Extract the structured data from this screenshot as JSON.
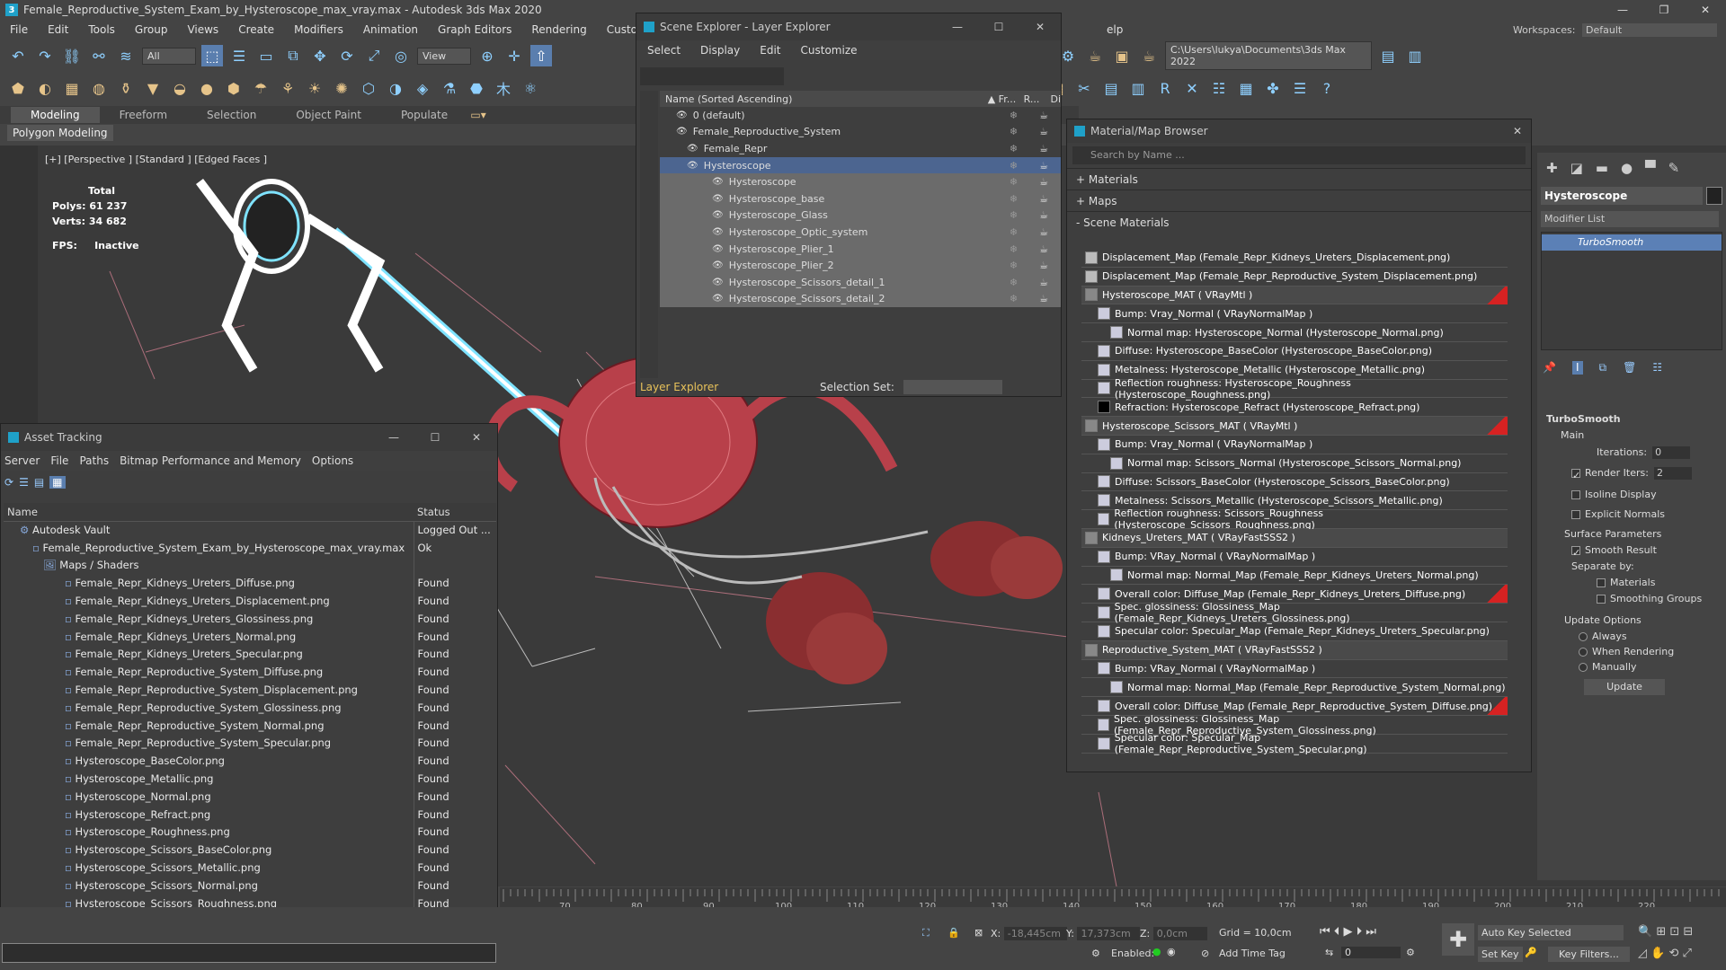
{
  "app": {
    "title": "Female_Reproductive_System_Exam_by_Hysteroscope_max_vray.max - Autodesk 3ds Max 2020",
    "menu": [
      "File",
      "Edit",
      "Tools",
      "Group",
      "Views",
      "Create",
      "Modifiers",
      "Animation",
      "Graph Editors",
      "Rendering",
      "Custo"
    ],
    "menu_tail": "elp",
    "workspaces_label": "Workspaces:",
    "workspace_value": "Default",
    "selection_filter": "All",
    "ref_coord": "View",
    "project_path": "C:\\Users\\lukya\\Documents\\3ds Max 2022"
  },
  "ribbon": {
    "tabs": [
      "Modeling",
      "Freeform",
      "Selection",
      "Object Paint",
      "Populate"
    ],
    "active": "Modeling",
    "sub": "Polygon Modeling"
  },
  "viewport": {
    "label": "[+] [Perspective ] [Standard ] [Edged Faces ]",
    "total_label": "Total",
    "polys_label": "Polys:",
    "polys": "61 237",
    "verts_label": "Verts:",
    "verts": "34 682",
    "fps_label": "FPS:",
    "fps": "Inactive"
  },
  "scene_explorer": {
    "title": "Scene Explorer - Layer Explorer",
    "menu": [
      "Select",
      "Display",
      "Edit",
      "Customize"
    ],
    "col_name": "Name (Sorted Ascending)",
    "col_fr": "▲ Fr...",
    "col_r": "R...",
    "col_d": "Di",
    "rows": [
      {
        "name": "0 (default)",
        "indent": 1
      },
      {
        "name": "Female_Reproductive_System",
        "indent": 1
      },
      {
        "name": "Female_Repr",
        "indent": 2
      },
      {
        "name": "Hysteroscope",
        "indent": 2
      },
      {
        "name": "Hysteroscope",
        "indent": 3
      },
      {
        "name": "Hysteroscope_base",
        "indent": 3
      },
      {
        "name": "Hysteroscope_Glass",
        "indent": 3
      },
      {
        "name": "Hysteroscope_Optic_system",
        "indent": 3
      },
      {
        "name": "Hysteroscope_Plier_1",
        "indent": 3
      },
      {
        "name": "Hysteroscope_Plier_2",
        "indent": 3
      },
      {
        "name": "Hysteroscope_Scissors_detail_1",
        "indent": 3
      },
      {
        "name": "Hysteroscope_Scissors_detail_2",
        "indent": 3
      }
    ],
    "footer_layer": "Layer Explorer",
    "footer_selset": "Selection Set:"
  },
  "asset_tracking": {
    "title": "Asset Tracking",
    "menu": [
      "Server",
      "File",
      "Paths",
      "Bitmap Performance and Memory",
      "Options"
    ],
    "col_name": "Name",
    "col_status": "Status",
    "rows": [
      {
        "name": "Autodesk Vault",
        "status": "Logged Out ...",
        "indent": 1
      },
      {
        "name": "Female_Reproductive_System_Exam_by_Hysteroscope_max_vray.max",
        "status": "Ok",
        "indent": 2
      },
      {
        "name": "Maps / Shaders",
        "status": "",
        "indent": 3
      },
      {
        "name": "Female_Repr_Kidneys_Ureters_Diffuse.png",
        "status": "Found",
        "indent": 4
      },
      {
        "name": "Female_Repr_Kidneys_Ureters_Displacement.png",
        "status": "Found",
        "indent": 4
      },
      {
        "name": "Female_Repr_Kidneys_Ureters_Glossiness.png",
        "status": "Found",
        "indent": 4
      },
      {
        "name": "Female_Repr_Kidneys_Ureters_Normal.png",
        "status": "Found",
        "indent": 4
      },
      {
        "name": "Female_Repr_Kidneys_Ureters_Specular.png",
        "status": "Found",
        "indent": 4
      },
      {
        "name": "Female_Repr_Reproductive_System_Diffuse.png",
        "status": "Found",
        "indent": 4
      },
      {
        "name": "Female_Repr_Reproductive_System_Displacement.png",
        "status": "Found",
        "indent": 4
      },
      {
        "name": "Female_Repr_Reproductive_System_Glossiness.png",
        "status": "Found",
        "indent": 4
      },
      {
        "name": "Female_Repr_Reproductive_System_Normal.png",
        "status": "Found",
        "indent": 4
      },
      {
        "name": "Female_Repr_Reproductive_System_Specular.png",
        "status": "Found",
        "indent": 4
      },
      {
        "name": "Hysteroscope_BaseColor.png",
        "status": "Found",
        "indent": 4
      },
      {
        "name": "Hysteroscope_Metallic.png",
        "status": "Found",
        "indent": 4
      },
      {
        "name": "Hysteroscope_Normal.png",
        "status": "Found",
        "indent": 4
      },
      {
        "name": "Hysteroscope_Refract.png",
        "status": "Found",
        "indent": 4
      },
      {
        "name": "Hysteroscope_Roughness.png",
        "status": "Found",
        "indent": 4
      },
      {
        "name": "Hysteroscope_Scissors_BaseColor.png",
        "status": "Found",
        "indent": 4
      },
      {
        "name": "Hysteroscope_Scissors_Metallic.png",
        "status": "Found",
        "indent": 4
      },
      {
        "name": "Hysteroscope_Scissors_Normal.png",
        "status": "Found",
        "indent": 4
      },
      {
        "name": "Hysteroscope_Scissors_Roughness.png",
        "status": "Found",
        "indent": 4
      }
    ]
  },
  "material_browser": {
    "title": "Material/Map Browser",
    "search_placeholder": "Search by Name ...",
    "sections": [
      "+ Materials",
      "+ Maps",
      "- Scene Materials"
    ],
    "rows": [
      {
        "text": "Displacement_Map (Female_Repr_Kidneys_Ureters_Displacement.png)",
        "level": 0,
        "head": false,
        "red": false
      },
      {
        "text": "Displacement_Map (Female_Repr_Reproductive_System_Displacement.png)",
        "level": 0,
        "head": false,
        "red": false
      },
      {
        "text": "Hysteroscope_MAT  ( VRayMtl )",
        "level": 0,
        "head": true,
        "red": true
      },
      {
        "text": "Bump: Vray_Normal  ( VRayNormalMap )",
        "level": 1,
        "head": false,
        "red": false
      },
      {
        "text": "Normal map: Hysteroscope_Normal (Hysteroscope_Normal.png)",
        "level": 2,
        "head": false,
        "red": false
      },
      {
        "text": "Diffuse: Hysteroscope_BaseColor (Hysteroscope_BaseColor.png)",
        "level": 1,
        "head": false,
        "red": false
      },
      {
        "text": "Metalness: Hysteroscope_Metallic (Hysteroscope_Metallic.png)",
        "level": 1,
        "head": false,
        "red": false
      },
      {
        "text": "Reflection roughness: Hysteroscope_Roughness (Hysteroscope_Roughness.png)",
        "level": 1,
        "head": false,
        "red": false
      },
      {
        "text": "Refraction: Hysteroscope_Refract (Hysteroscope_Refract.png)",
        "level": 1,
        "head": false,
        "red": false
      },
      {
        "text": "Hysteroscope_Scissors_MAT  ( VRayMtl )",
        "level": 0,
        "head": true,
        "red": true
      },
      {
        "text": "Bump: Vray_Normal  ( VRayNormalMap )",
        "level": 1,
        "head": false,
        "red": false
      },
      {
        "text": "Normal map: Scissors_Normal (Hysteroscope_Scissors_Normal.png)",
        "level": 2,
        "head": false,
        "red": false
      },
      {
        "text": "Diffuse: Scissors_BaseColor (Hysteroscope_Scissors_BaseColor.png)",
        "level": 1,
        "head": false,
        "red": false
      },
      {
        "text": "Metalness: Scissors_Metallic (Hysteroscope_Scissors_Metallic.png)",
        "level": 1,
        "head": false,
        "red": false
      },
      {
        "text": "Reflection roughness: Scissors_Roughness (Hysteroscope_Scissors_Roughness.png)",
        "level": 1,
        "head": false,
        "red": false
      },
      {
        "text": "Kidneys_Ureters_MAT  ( VRayFastSSS2 )",
        "level": 0,
        "head": true,
        "red": false
      },
      {
        "text": "Bump: VRay_Normal  ( VRayNormalMap )",
        "level": 1,
        "head": false,
        "red": false
      },
      {
        "text": "Normal map: Normal_Map (Female_Repr_Kidneys_Ureters_Normal.png)",
        "level": 2,
        "head": false,
        "red": false
      },
      {
        "text": "Overall color: Diffuse_Map (Female_Repr_Kidneys_Ureters_Diffuse.png)",
        "level": 1,
        "head": false,
        "red": true
      },
      {
        "text": "Spec. glossiness: Glossiness_Map (Female_Repr_Kidneys_Ureters_Glossiness.png)",
        "level": 1,
        "head": false,
        "red": false
      },
      {
        "text": "Specular color: Specular_Map (Female_Repr_Kidneys_Ureters_Specular.png)",
        "level": 1,
        "head": false,
        "red": false
      },
      {
        "text": "Reproductive_System_MAT  ( VRayFastSSS2 )",
        "level": 0,
        "head": true,
        "red": false
      },
      {
        "text": "Bump: VRay_Normal  ( VRayNormalMap )",
        "level": 1,
        "head": false,
        "red": false
      },
      {
        "text": "Normal map: Normal_Map (Female_Repr_Reproductive_System_Normal.png)",
        "level": 2,
        "head": false,
        "red": false
      },
      {
        "text": "Overall color: Diffuse_Map (Female_Repr_Reproductive_System_Diffuse.png)",
        "level": 1,
        "head": false,
        "red": true
      },
      {
        "text": "Spec. glossiness: Glossiness_Map (Female_Repr_Reproductive_System_Glossiness.png)",
        "level": 1,
        "head": false,
        "red": false
      },
      {
        "text": "Specular color: Specular_Map (Female_Repr_Reproductive_System_Specular.png)",
        "level": 1,
        "head": false,
        "red": false
      }
    ]
  },
  "command_panel": {
    "object_name": "Hysteroscope",
    "modifier_list": "Modifier List",
    "stack_item": "TurboSmooth",
    "rollout": "TurboSmooth",
    "main": "Main",
    "iterations_label": "Iterations:",
    "iterations": "0",
    "render_iters_label": "Render Iters:",
    "render_iters": "2",
    "isoline": "Isoline Display",
    "explicit": "Explicit Normals",
    "surface_params": "Surface Parameters",
    "smooth_result": "Smooth Result",
    "separate_by": "Separate by:",
    "materials": "Materials",
    "smoothing_groups": "Smoothing Groups",
    "update_options": "Update Options",
    "always": "Always",
    "when_rendering": "When Rendering",
    "manually": "Manually",
    "update_btn": "Update"
  },
  "timeline": {
    "ticks": [
      "70",
      "80",
      "90",
      "100",
      "110",
      "120",
      "130",
      "140",
      "150",
      "160",
      "170",
      "180",
      "190",
      "200",
      "210",
      "220"
    ]
  },
  "status": {
    "x_label": "X:",
    "x": "-18,445cm",
    "y_label": "Y:",
    "y": "17,373cm",
    "z_label": "Z:",
    "z": "0,0cm",
    "grid": "Grid = 10,0cm",
    "enabled": "Enabled:",
    "add_time_tag": "Add Time Tag",
    "auto_key": "Auto Key",
    "selected": "Selected",
    "set_key": "Set Key",
    "key_filters": "Key Filters...",
    "frame": "0"
  }
}
